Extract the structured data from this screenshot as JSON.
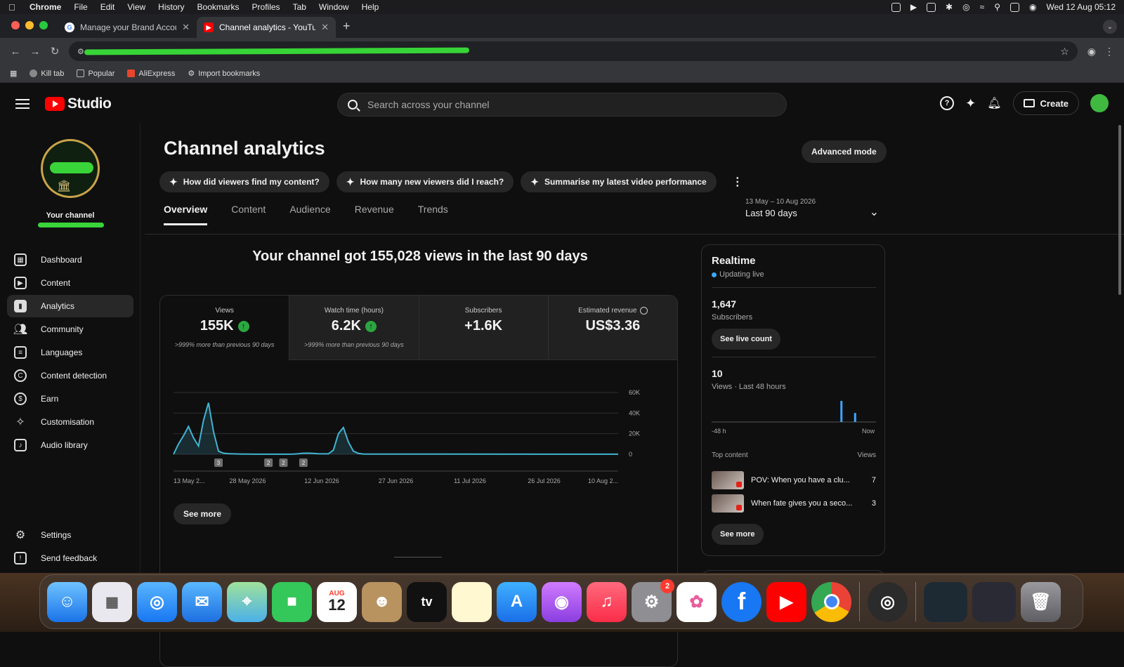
{
  "menubar": {
    "app": "Chrome",
    "items": [
      "File",
      "Edit",
      "View",
      "History",
      "Bookmarks",
      "Profiles",
      "Tab",
      "Window",
      "Help"
    ],
    "clock": "Wed 12 Aug  05:12"
  },
  "browser": {
    "tabs": [
      {
        "title": "Manage your Brand Account",
        "active": false
      },
      {
        "title": "Channel analytics - YouTube S",
        "active": true
      }
    ],
    "bookmarks": [
      "Kill tab",
      "Popular",
      "AliExpress",
      "Import bookmarks"
    ]
  },
  "header": {
    "logo_text": "Studio",
    "search_placeholder": "Search across your channel",
    "help_icon": "?",
    "create_label": "Create"
  },
  "sidebar": {
    "channel_label": "Your channel",
    "items": [
      {
        "label": "Dashboard",
        "icon": "dashboard-icon",
        "active": false
      },
      {
        "label": "Content",
        "icon": "content-icon",
        "active": false
      },
      {
        "label": "Analytics",
        "icon": "analytics-icon",
        "active": true
      },
      {
        "label": "Community",
        "icon": "community-icon",
        "active": false
      },
      {
        "label": "Languages",
        "icon": "languages-icon",
        "active": false
      },
      {
        "label": "Content detection",
        "icon": "copyright-icon",
        "active": false
      },
      {
        "label": "Earn",
        "icon": "dollar-icon",
        "active": false
      },
      {
        "label": "Customisation",
        "icon": "magic-wand-icon",
        "active": false
      },
      {
        "label": "Audio library",
        "icon": "audio-library-icon",
        "active": false
      }
    ],
    "bottom": [
      {
        "label": "Settings",
        "icon": "gear-icon"
      },
      {
        "label": "Send feedback",
        "icon": "feedback-icon"
      }
    ]
  },
  "main": {
    "title": "Channel analytics",
    "advanced_mode": "Advanced mode",
    "chips": [
      "How did viewers find my content?",
      "How many new viewers did I reach?",
      "Summarise my latest video performance"
    ],
    "tabs": [
      "Overview",
      "Content",
      "Audience",
      "Revenue",
      "Trends"
    ],
    "active_tab": "Overview",
    "date_range": {
      "range": "13 May – 10 Aug 2026",
      "label": "Last 90 days"
    },
    "headline": "Your channel got 155,028 views in the last 90 days",
    "kpis": [
      {
        "label": "Views",
        "value": "155K",
        "up": true,
        "compare": ">999% more than previous 90 days"
      },
      {
        "label": "Watch time (hours)",
        "value": "6.2K",
        "up": true,
        "compare": ">999% more than previous 90 days"
      },
      {
        "label": "Subscribers",
        "value": "+1.6K",
        "up": false,
        "compare": ""
      },
      {
        "label": "Estimated revenue",
        "value": "US$3.36",
        "up": false,
        "compare": ""
      }
    ],
    "see_more": "See more"
  },
  "chart_data": {
    "type": "area",
    "x_tick_labels": [
      "13 May 2...",
      "28 May 2026",
      "12 Jun 2026",
      "27 Jun 2026",
      "11 Jul 2026",
      "26 Jul 2026",
      "10 Aug 2..."
    ],
    "y_tick_labels": [
      "60K",
      "40K",
      "20K",
      "0"
    ],
    "ylim": [
      0,
      60000
    ],
    "xlim_days": [
      0,
      89
    ],
    "grid": true,
    "y_axis_side": "right",
    "series": [
      {
        "x": [
          0,
          1,
          2,
          3,
          4,
          5,
          6,
          7,
          8,
          9,
          10,
          11,
          12,
          13,
          14,
          15,
          16,
          17,
          18,
          19,
          20,
          21,
          22,
          23,
          24,
          25,
          26,
          27,
          28,
          29,
          30,
          31,
          32,
          33,
          34,
          35,
          36,
          37,
          38,
          89
        ],
        "values": [
          0,
          10000,
          18000,
          27000,
          16000,
          8000,
          33000,
          50000,
          22000,
          3000,
          1000,
          600,
          400,
          300,
          200,
          150,
          100,
          100,
          100,
          100,
          100,
          100,
          100,
          100,
          200,
          500,
          1000,
          1100,
          900,
          500,
          400,
          400,
          4000,
          20000,
          26000,
          12000,
          3000,
          800,
          200,
          100
        ]
      }
    ],
    "annotations": [
      {
        "x": 9,
        "label": "3"
      },
      {
        "x": 19,
        "label": "2"
      },
      {
        "x": 22,
        "label": "2"
      },
      {
        "x": 26,
        "label": "2"
      }
    ],
    "color": "#41b4d2"
  },
  "realtime": {
    "title": "Realtime",
    "live_label": "Updating live",
    "subscribers_value": "1,647",
    "subscribers_label": "Subscribers",
    "see_live_count": "See live count",
    "views_value": "10",
    "views_label": "Views · Last 48 hours",
    "axis_left": "-48 h",
    "axis_right": "Now",
    "mini_chart": {
      "type": "bar",
      "hours": [
        -48,
        0
      ],
      "bars": [
        {
          "hour": -10,
          "value": 7
        },
        {
          "hour": -6,
          "value": 3
        }
      ],
      "max": 7
    },
    "top_content_label": "Top content",
    "views_col_label": "Views",
    "top_content": [
      {
        "title": "POV: When you have a clu...",
        "views": "7"
      },
      {
        "title": "When fate gives you a seco...",
        "views": "3"
      }
    ],
    "see_more": "See more"
  },
  "dock": {
    "calendar_month": "AUG",
    "calendar_day": "12",
    "settings_badge": "2"
  }
}
